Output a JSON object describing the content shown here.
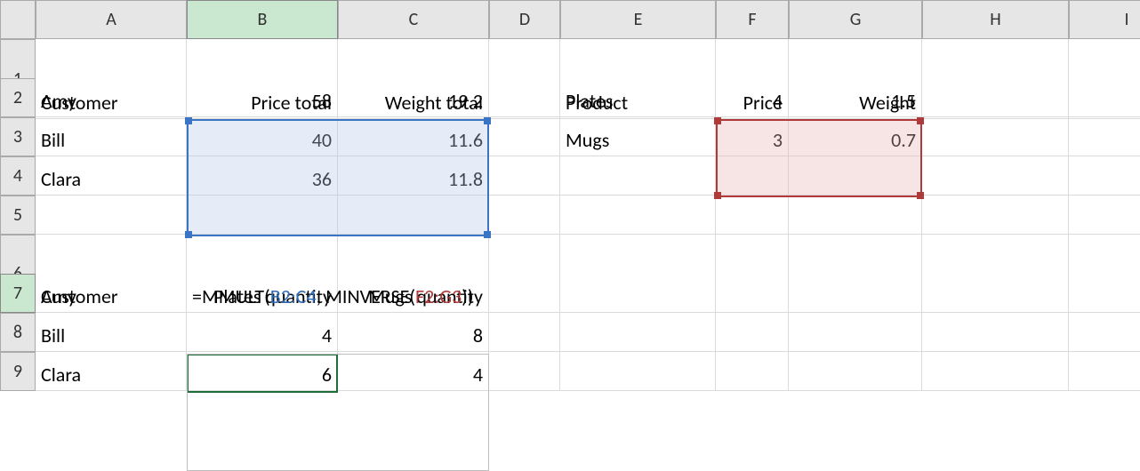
{
  "columns": [
    "A",
    "B",
    "C",
    "D",
    "E",
    "F",
    "G",
    "H",
    "I"
  ],
  "rows": [
    "1",
    "2",
    "3",
    "4",
    "5",
    "6",
    "7",
    "8",
    "9"
  ],
  "cells": {
    "A1": "Customer",
    "B1": "Price total",
    "C1": "Weight total",
    "E1": "Product",
    "F1": "Price",
    "G1": "Weight",
    "A2": "Amy",
    "B2": "58",
    "C2": "19.2",
    "E2": "Plates",
    "F2": "4",
    "G2": "1.5",
    "A3": "Bill",
    "B3": "40",
    "C3": "11.6",
    "E3": "Mugs",
    "F3": "3",
    "G3": "0.7",
    "A4": "Clara",
    "B4": "36",
    "C4": "11.8",
    "A6": "Customer",
    "B6": "Plates quantity",
    "C6": "Mugs quantity",
    "A7": "Amy",
    "A8": "Bill",
    "B8": "4",
    "C8": "8",
    "A9": "Clara",
    "B9": "6",
    "C9": "4"
  },
  "formula": {
    "prefix": "=MMULT(",
    "ref1": "B2:C4",
    "mid": ", MINVERSE(",
    "ref2": "F2:G3",
    "suffix": "))"
  }
}
